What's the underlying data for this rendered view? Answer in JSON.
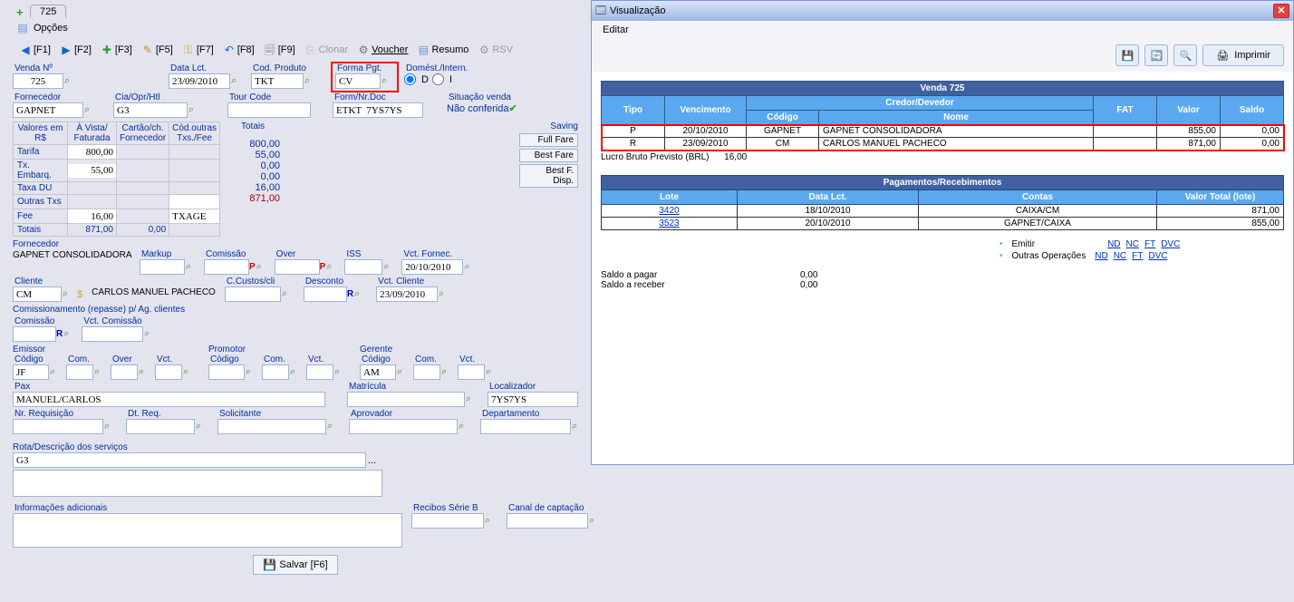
{
  "tab": "725",
  "opcoes": "Opções",
  "toolbar": {
    "f1": "[F1]",
    "f2": "[F2]",
    "f3": "[F3]",
    "f5": "[F5]",
    "f7": "[F7]",
    "f8": "[F8]",
    "f9": "[F9]",
    "clonar": "Clonar",
    "voucher": "Voucher",
    "resumo": "Resumo",
    "rsv": "RSV"
  },
  "fields": {
    "venda_n_lbl": "Venda Nº",
    "venda_n": "725",
    "data_lct_lbl": "Data Lct.",
    "data_lct": "23/09/2010",
    "cod_prod_lbl": "Cod. Produto",
    "cod_prod": "TKT",
    "forma_pgt_lbl": "Forma Pgt.",
    "forma_pgt": "CV",
    "dom_int_lbl": "Domést./Intern.",
    "dom": "D",
    "int": "I",
    "fornecedor_lbl": "Fornecedor",
    "fornecedor": "GAPNET",
    "cia_lbl": "Cia/Opr/Htl",
    "cia": "G3",
    "tour_lbl": "Tour Code",
    "tour": "",
    "form_nr_lbl": "Form/Nr.Doc",
    "form_nr": "ETKT  7YS7YS",
    "sit_lbl": "Situação venda",
    "sit": "Não conferida"
  },
  "vals": {
    "h_valores": "Valores em R$",
    "h_avista": "À Vista/ Faturada",
    "h_cartao": "Cartão/ch. Fornecedor",
    "h_cod": "Cód.outras Txs./Fee",
    "h_totais": "Totais",
    "tarifa_lbl": "Tarifa",
    "tarifa": "800,00",
    "tot_tarifa": "800,00",
    "tx_embarq_lbl": "Tx. Embarq.",
    "tx_embarq": "55,00",
    "tot_emb": "55,00",
    "taxa_du_lbl": "Taxa DU",
    "tot_du": "0,00",
    "outras_lbl": "Outras Txs",
    "tot_outras": "0,00",
    "fee_lbl": "Fee",
    "fee": "16,00",
    "fee_code": "TXAGE",
    "tot_fee": "16,00",
    "totais_lbl": "Totais",
    "totais": "871,00",
    "zero": "0,00",
    "gtot": "871,00"
  },
  "sav": {
    "saving": "Saving",
    "full": "Full Fare",
    "best": "Best Fare",
    "bestd": "Best F. Disp."
  },
  "forn2": {
    "lbl": "Fornecedor",
    "nome": "GAPNET CONSOLIDADORA",
    "markup": "Markup",
    "comissao": "Comissão",
    "over": "Over",
    "iss": "ISS",
    "vct": "Vct. Fornec.",
    "vctval": "20/10/2010"
  },
  "cliente": {
    "lbl": "Cliente",
    "cod": "CM",
    "nome": "CARLOS MANUEL PACHECO",
    "ccustos": "C.Custos/cli",
    "desconto": "Desconto",
    "vct": "Vct. Cliente",
    "vctval": "23/09/2010"
  },
  "repasse": {
    "hdr": "Comissionamento (repasse) p/ Ag. clientes",
    "comissao": "Comissão",
    "vct": "Vct. Comissão"
  },
  "emissor": {
    "hdr": "Emissor",
    "codigo": "Código",
    "com": "Com.",
    "over": "Over",
    "vct": "Vct.",
    "val": "JF"
  },
  "promotor": {
    "hdr": "Promotor",
    "codigo": "Código",
    "com": "Com.",
    "vct": "Vct."
  },
  "gerente": {
    "hdr": "Gerente",
    "codigo": "Código",
    "com": "Com.",
    "vct": "Vct.",
    "val": "AM"
  },
  "pax": {
    "lbl": "Pax",
    "val": "MANUEL/CARLOS",
    "matricula": "Matrícula",
    "localizador": "Localizador",
    "locval": "7YS7YS"
  },
  "req": {
    "nr": "Nr. Requisição",
    "dt": "Dt. Req.",
    "sol": "Solicitante",
    "apr": "Aprovador",
    "dep": "Departamento"
  },
  "rota": {
    "lbl": "Rota/Descrição dos serviços",
    "val": "G3"
  },
  "info": {
    "lbl": "Informações adicionais"
  },
  "recibos": "Recibos Série B",
  "canal": "Canal de captação",
  "salvar": "Salvar [F6]",
  "viz": {
    "title": "Visualização",
    "editar": "Editar",
    "imprimir": "Imprimir",
    "venda_hdr": "Venda  725",
    "cols": {
      "tipo": "Tipo",
      "venc": "Vencimento",
      "cred": "Credor/Devedor",
      "cod": "Código",
      "nome": "Nome",
      "fat": "FAT",
      "valor": "Valor",
      "saldo": "Saldo"
    },
    "rows": [
      {
        "tipo": "P",
        "venc": "20/10/2010",
        "cod": "GAPNET",
        "nome": "GAPNET CONSOLIDADORA",
        "fat": "",
        "valor": "855,00",
        "saldo": "0,00"
      },
      {
        "tipo": "R",
        "venc": "23/09/2010",
        "cod": "CM",
        "nome": "CARLOS MANUEL PACHECO",
        "fat": "",
        "valor": "871,00",
        "saldo": "0,00"
      }
    ],
    "lucro_lbl": "Lucro Bruto Previsto (BRL)",
    "lucro": "16,00",
    "pag_hdr": "Pagamentos/Recebimentos",
    "pcols": {
      "lote": "Lote",
      "data": "Data Lct.",
      "contas": "Contas",
      "vtot": "Valor Total (lote)"
    },
    "prows": [
      {
        "lote": "3420",
        "data": "18/10/2010",
        "contas": "CAIXA/CM",
        "vtot": "871,00"
      },
      {
        "lote": "3523",
        "data": "20/10/2010",
        "contas": "GAPNET/CAIXA",
        "vtot": "855,00"
      }
    ],
    "emitir": "Emitir",
    "outras": "Outras Operações",
    "lk": {
      "nd": "ND",
      "nc": "NC",
      "ft": "FT",
      "dvc": "DVC"
    },
    "saldo_pagar_lbl": "Saldo a pagar",
    "saldo_pagar": "0,00",
    "saldo_receber_lbl": "Saldo a receber",
    "saldo_receber": "0,00"
  }
}
